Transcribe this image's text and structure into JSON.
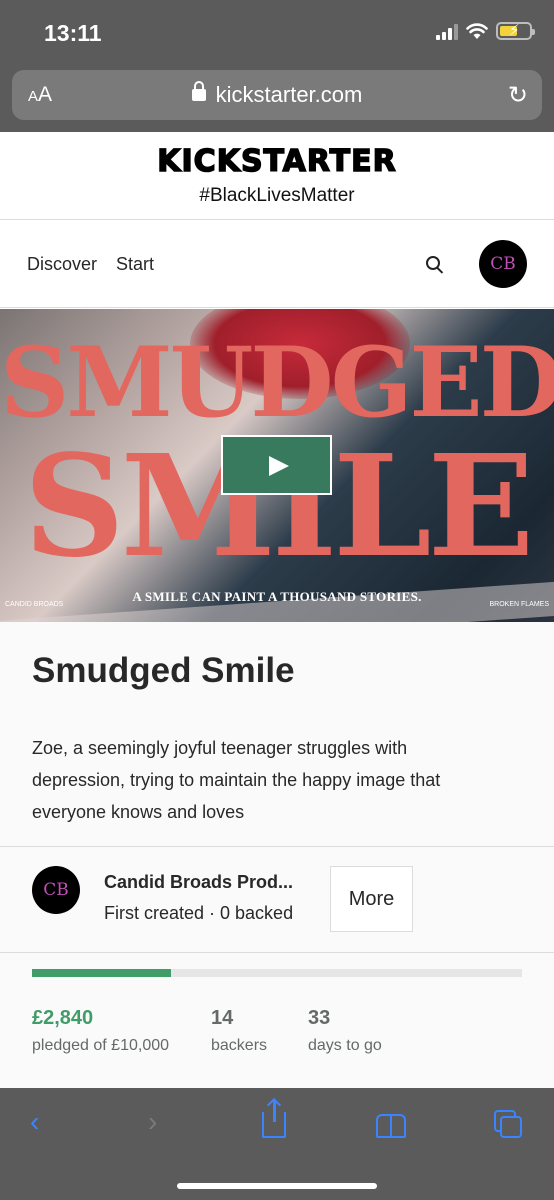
{
  "status_bar": {
    "time": "13:11",
    "icons": [
      "cellular-signal-icon",
      "wifi-icon",
      "battery-charging-icon"
    ]
  },
  "browser": {
    "text_size_button": "AA",
    "url": "kickstarter.com",
    "reload_icon": "reload-icon"
  },
  "header": {
    "logo": "KICKSTARTER",
    "tagline": "#BlackLivesMatter"
  },
  "nav": {
    "discover": "Discover",
    "start": "Start",
    "search_icon": "search-icon",
    "avatar_initials": "CB"
  },
  "hero": {
    "title_line_1": "SMUDGED",
    "title_line_2": "SMILE",
    "tagline": "A SMILE CAN PAINT A THOUSAND STORIES.",
    "brand_left": "CANDID BROADS",
    "brand_right": "BROKEN FLAMES",
    "play_icon": "play-icon"
  },
  "project": {
    "title": "Smudged Smile",
    "description": "Zoe, a seemingly joyful teenager struggles with depression, trying to maintain the happy image that everyone knows and loves"
  },
  "creator": {
    "avatar_initials": "CB",
    "name": "Candid Broads Prod...",
    "meta": "First created · 0 backed",
    "more_label": "More"
  },
  "funding": {
    "progress_fraction": 0.284,
    "pledged": "£2,840",
    "pledged_label": "pledged of £10,000",
    "backers": "14",
    "backers_label": "backers",
    "days": "33",
    "days_label": "days to go"
  },
  "toolbar": {
    "back": "‹",
    "forward": "›"
  },
  "colors": {
    "accent_green": "#409c68",
    "hero_type": "#e2675f",
    "play_button": "#387a5e",
    "safari_blue": "#3b84ff"
  }
}
